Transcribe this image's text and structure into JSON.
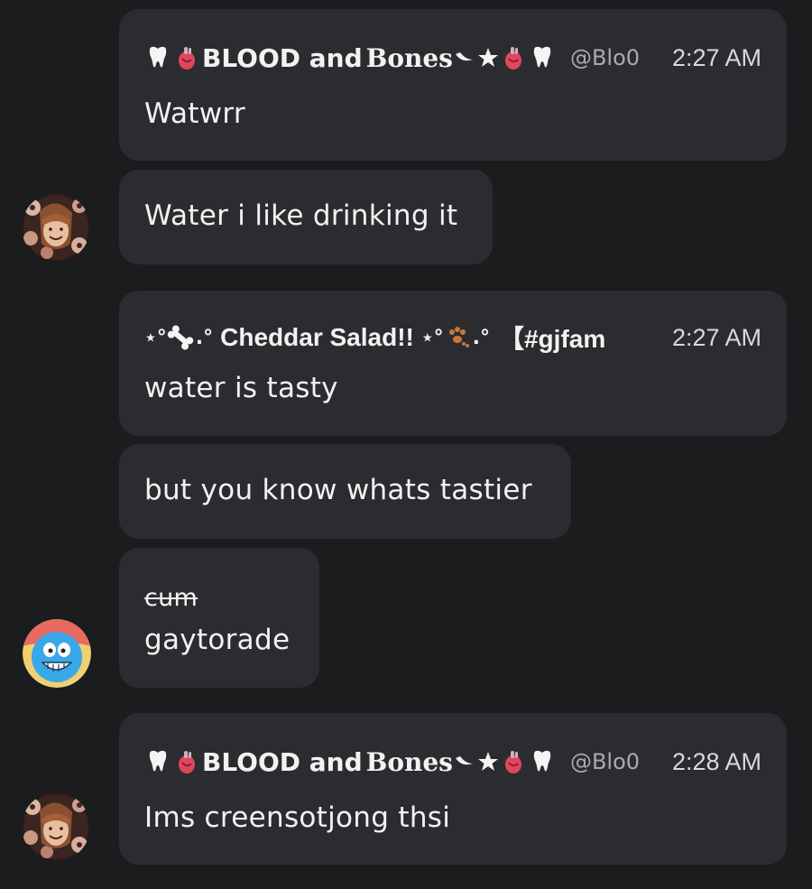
{
  "messages": [
    {
      "name_before": "BLOOD and ",
      "name_fancy": "Bones",
      "handle": "@Blo0",
      "time": "2:27 AM",
      "text": "Watwrr"
    },
    {
      "text": "Water i like drinking it"
    },
    {
      "name_prefix": "⋆°",
      "name": "Cheddar Salad!!",
      "name_suffix": "⋆°",
      "tag": "【#gjfam",
      "time": "2:27 AM",
      "text": "water is tasty"
    },
    {
      "text": "but you know whats tastier"
    },
    {
      "struck_text": "cum",
      "text": "gaytorade"
    },
    {
      "name_before": "BLOOD and ",
      "name_fancy": "Bones",
      "handle": "@Blo0",
      "time": "2:28 AM",
      "text": "Ims creensotjong thsi"
    }
  ],
  "icons": {
    "tooth": "tooth-icon",
    "heart": "anatomical-heart-icon",
    "bone": "bone-icon",
    "paw": "paw-prints-icon",
    "pentagram": "pentagram-icon"
  },
  "colors": {
    "background": "#1b1c1e",
    "bubble": "#2b2c2f",
    "text": "#f2f2f2",
    "muted": "#a9aaae"
  }
}
